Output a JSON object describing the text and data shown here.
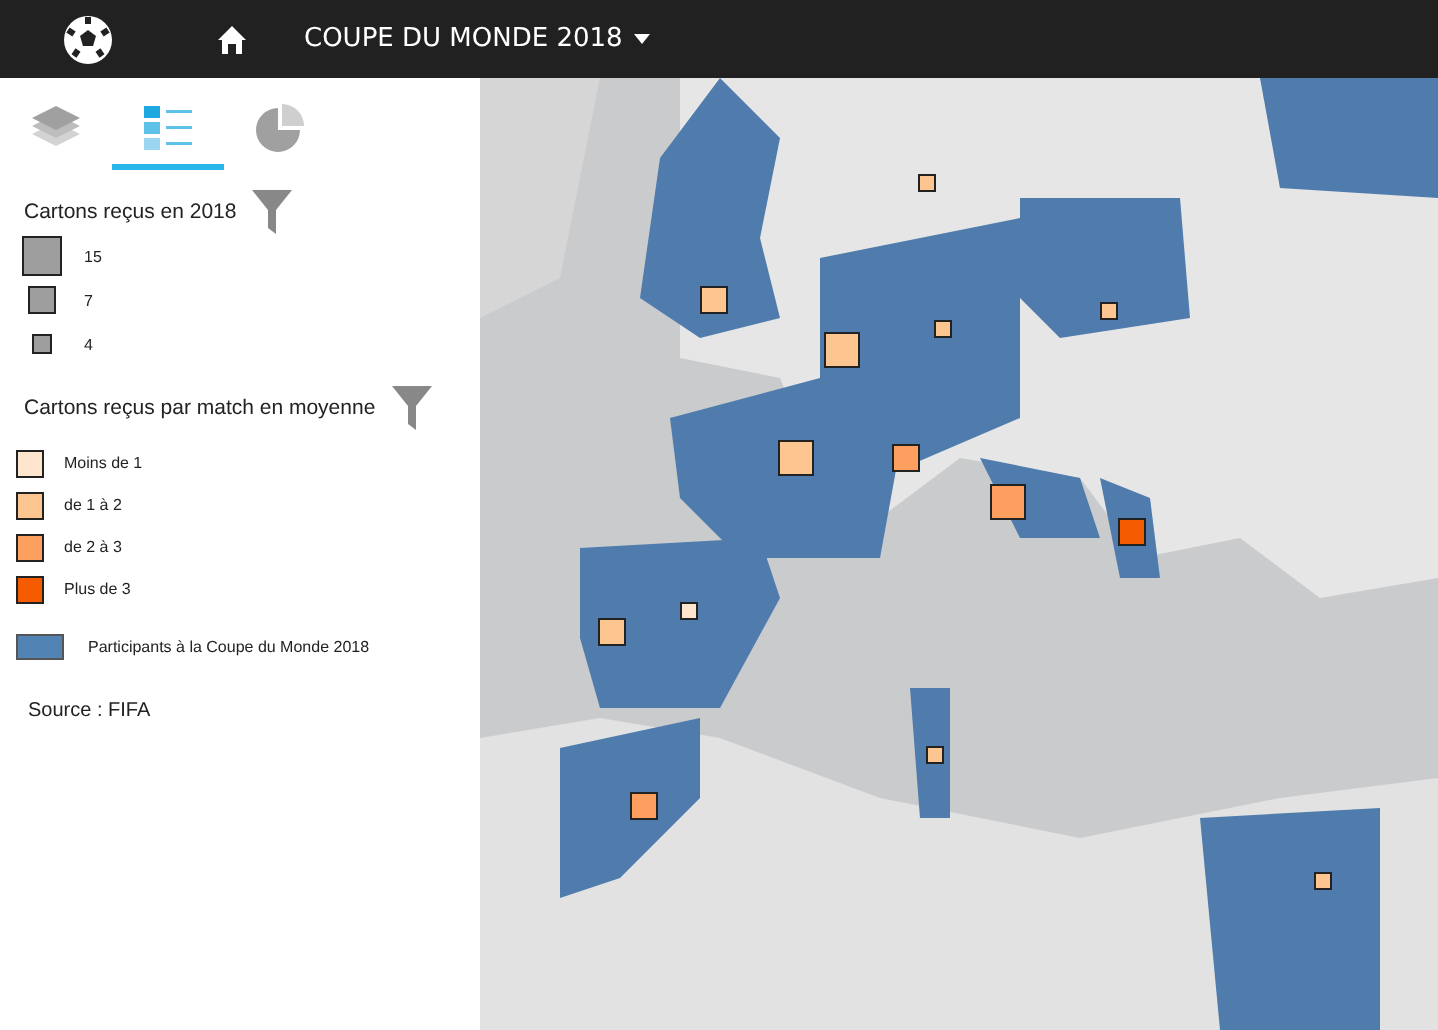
{
  "header": {
    "title": "COUPE DU MONDE 2018"
  },
  "tabs": [
    {
      "kind": "layers",
      "selected": false
    },
    {
      "kind": "legend",
      "selected": true
    },
    {
      "kind": "chart",
      "selected": false
    }
  ],
  "size_legend": {
    "title": "Cartons reçus en 2018",
    "items": [
      {
        "label": "15",
        "kind": "large"
      },
      {
        "label": "7",
        "kind": "medium"
      },
      {
        "label": "4",
        "kind": "small"
      }
    ]
  },
  "color_legend": {
    "title": "Cartons reçus par match en moyenne",
    "items": [
      {
        "label": "Moins de 1",
        "color": "#fee6ce"
      },
      {
        "label": "de 1 à 2",
        "color": "#fdc590"
      },
      {
        "label": "de 2 à 3",
        "color": "#fd9f5e"
      },
      {
        "label": "Plus de 3",
        "color": "#f55b00"
      }
    ]
  },
  "participants": {
    "label": "Participants à la Coupe du Monde 2018",
    "color": "#5283b5"
  },
  "source": "Source : FIFA",
  "map": {
    "markers": [
      {
        "kind": "small",
        "color": "#fdc590"
      },
      {
        "kind": "medium",
        "color": "#fdc590"
      },
      {
        "kind": "large",
        "color": "#fdc590"
      },
      {
        "kind": "small",
        "color": "#fdc590"
      },
      {
        "kind": "small",
        "color": "#fdc590"
      },
      {
        "kind": "large",
        "color": "#fdc590"
      },
      {
        "kind": "medium",
        "color": "#fd9f5e"
      },
      {
        "kind": "large",
        "color": "#fd9f5e"
      },
      {
        "kind": "medium",
        "color": "#f55b00"
      },
      {
        "kind": "medium",
        "color": "#fdc590"
      },
      {
        "kind": "small",
        "color": "#fee6ce"
      },
      {
        "kind": "small",
        "color": "#fdc590"
      },
      {
        "kind": "medium",
        "color": "#fd9f5e"
      },
      {
        "kind": "small",
        "color": "#fdc590"
      }
    ]
  }
}
